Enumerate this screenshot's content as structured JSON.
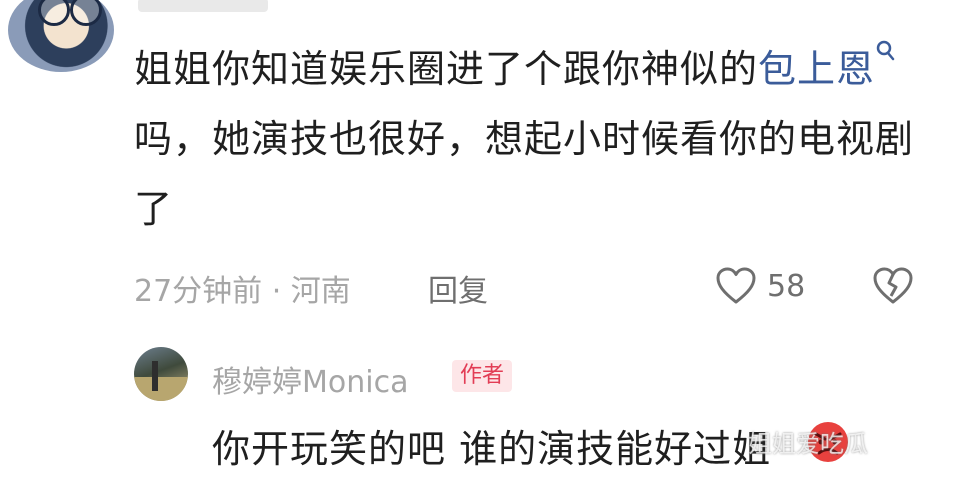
{
  "comment": {
    "author_avatar": "avatar",
    "text_before_mention": "姐姐你知道娱乐圈进了个跟你神似的",
    "mention": "包上恩",
    "mention_icon": "search-icon",
    "text_after_mention": "吗，她演技也很好，想起小时候看你的电视剧了",
    "time_location": "27分钟前 · 河南",
    "reply_label": "回复",
    "like_icon": "heart-icon",
    "like_count": "58",
    "dislike_icon": "broken-heart-icon"
  },
  "reply": {
    "author_avatar": "avatar",
    "author_name": "穆婷婷Monica",
    "author_badge": "作者",
    "text": "你开玩笑的吧 谁的演技能好过姐",
    "emoji": "angry-face-icon"
  },
  "watermark": "姐姐爱吃瓜",
  "colors": {
    "mention": "#3b5c9a",
    "meta_text": "#a6a6a6",
    "badge_bg": "#fde6e8",
    "badge_text": "#e23d55",
    "angry_face": "#e8413e"
  }
}
